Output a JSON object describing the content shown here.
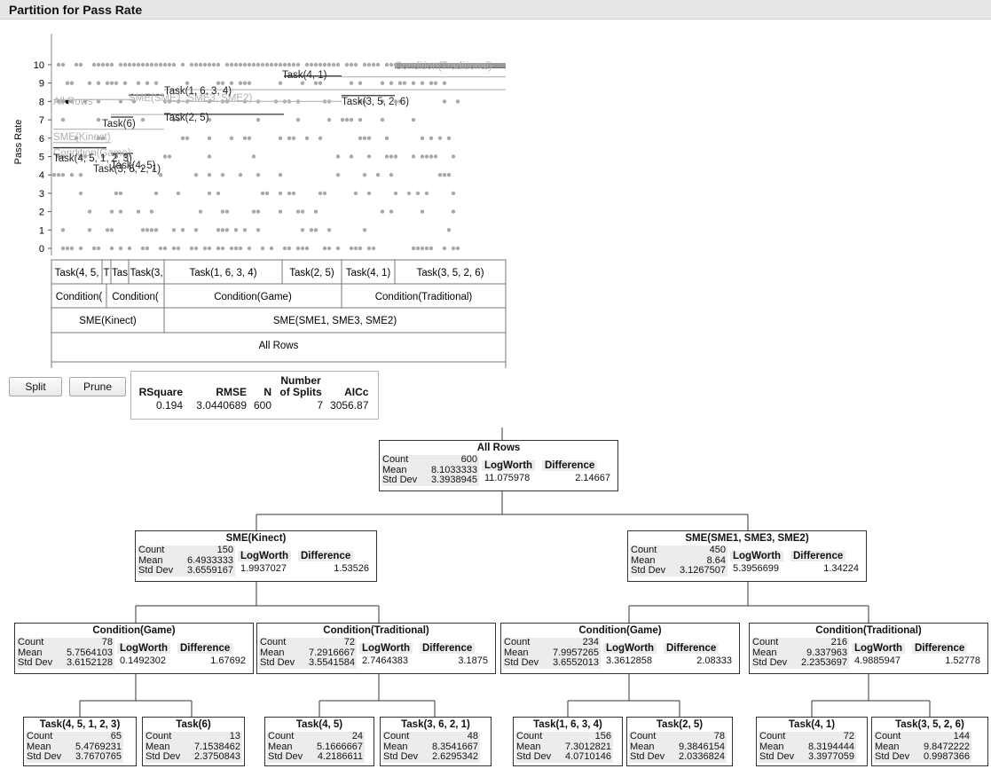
{
  "title": "Partition for Pass Rate",
  "plot": {
    "ylabel": "Pass Rate",
    "y_ticks": [
      "0",
      "1",
      "2",
      "3",
      "4",
      "5",
      "6",
      "7",
      "8",
      "9",
      "10"
    ],
    "segment_labels": [
      {
        "text": "All Rows",
        "row": -1
      },
      {
        "text": "SME(Kinect)",
        "row": -1
      },
      {
        "text": "Condition(Game)",
        "row": -1
      },
      {
        "text": "Task(4, 5, 1, 2, 3)",
        "row": 0
      },
      {
        "text": "Task(4, 5)",
        "row": 0
      },
      {
        "text": "Task(6)",
        "row": 0
      },
      {
        "text": "Task(3, 6, 2, 1)",
        "row": 0
      },
      {
        "text": "SME(SME1, SME3, SME2)",
        "row": -1
      },
      {
        "text": "Task(1, 6, 3, 4)",
        "row": 0
      },
      {
        "text": "Task(2, 5)",
        "row": 0
      },
      {
        "text": "Task(4, 1)",
        "row": 0
      },
      {
        "text": "Task(3, 5, 2, 6)",
        "row": 0
      },
      {
        "text": "Condition(Traditional)",
        "row": -1
      }
    ],
    "rows": {
      "task": [
        "Task(4, 5,",
        "T",
        "Tas",
        "Task(3,",
        "Task(1, 6, 3, 4)",
        "Task(2, 5)",
        "Task(4, 1)",
        "Task(3, 5, 2, 6)"
      ],
      "condition": [
        "Condition(",
        "Condition(",
        "Condition(Game)",
        "Condition(Traditional)"
      ],
      "sme": [
        "SME(Kinect)",
        "SME(SME1, SME3, SME2)"
      ],
      "all": [
        "All Rows"
      ]
    }
  },
  "buttons": {
    "split": "Split",
    "prune": "Prune"
  },
  "stats": {
    "headers": [
      "RSquare",
      "RMSE",
      "N",
      "Number of Splits",
      "AICc"
    ],
    "h_number": "Number",
    "h_splits": "of Splits",
    "values": [
      "0.194",
      "3.0440689",
      "600",
      "7",
      "3056.87"
    ]
  },
  "tree": {
    "root": {
      "title": "All Rows",
      "count": "600",
      "mean": "8.1033333",
      "std": "3.3938945",
      "logworth": "11.075978",
      "difference": "2.14667"
    },
    "l1": [
      {
        "title": "SME(Kinect)",
        "count": "150",
        "mean": "6.4933333",
        "std": "3.6559167",
        "logworth": "1.9937027",
        "difference": "1.53526"
      },
      {
        "title": "SME(SME1, SME3, SME2)",
        "count": "450",
        "mean": "8.64",
        "std": "3.1267507",
        "logworth": "5.3956699",
        "difference": "1.34224"
      }
    ],
    "l2": [
      {
        "title": "Condition(Game)",
        "count": "78",
        "mean": "5.7564103",
        "std": "3.6152128",
        "logworth": "0.1492302",
        "difference": "1.67692"
      },
      {
        "title": "Condition(Traditional)",
        "count": "72",
        "mean": "7.2916667",
        "std": "3.5541584",
        "logworth": "2.7464383",
        "difference": "3.1875"
      },
      {
        "title": "Condition(Game)",
        "count": "234",
        "mean": "7.9957265",
        "std": "3.6552013",
        "logworth": "3.3612858",
        "difference": "2.08333"
      },
      {
        "title": "Condition(Traditional)",
        "count": "216",
        "mean": "9.337963",
        "std": "2.2353697",
        "logworth": "4.9885947",
        "difference": "1.52778"
      }
    ],
    "l3": [
      {
        "title": "Task(4, 5, 1, 2, 3)",
        "count": "65",
        "mean": "5.4769231",
        "std": "3.7670765"
      },
      {
        "title": "Task(6)",
        "count": "13",
        "mean": "7.1538462",
        "std": "2.3750843"
      },
      {
        "title": "Task(4, 5)",
        "count": "24",
        "mean": "5.1666667",
        "std": "4.2186611"
      },
      {
        "title": "Task(3, 6, 2, 1)",
        "count": "48",
        "mean": "8.3541667",
        "std": "2.6295342"
      },
      {
        "title": "Task(1, 6, 3, 4)",
        "count": "156",
        "mean": "7.3012821",
        "std": "4.0710146"
      },
      {
        "title": "Task(2, 5)",
        "count": "78",
        "mean": "9.3846154",
        "std": "2.0336824"
      },
      {
        "title": "Task(4, 1)",
        "count": "72",
        "mean": "8.3194444",
        "std": "3.3977059"
      },
      {
        "title": "Task(3, 5, 2, 6)",
        "count": "144",
        "mean": "9.8472222",
        "std": "0.9987366"
      }
    ],
    "labels": {
      "count": "Count",
      "mean": "Mean",
      "std": "Std Dev",
      "logworth": "LogWorth",
      "difference": "Difference"
    }
  },
  "colors": {
    "points": "#a9a9a9",
    "highlight_point": "#000000",
    "lines": "#333333"
  }
}
